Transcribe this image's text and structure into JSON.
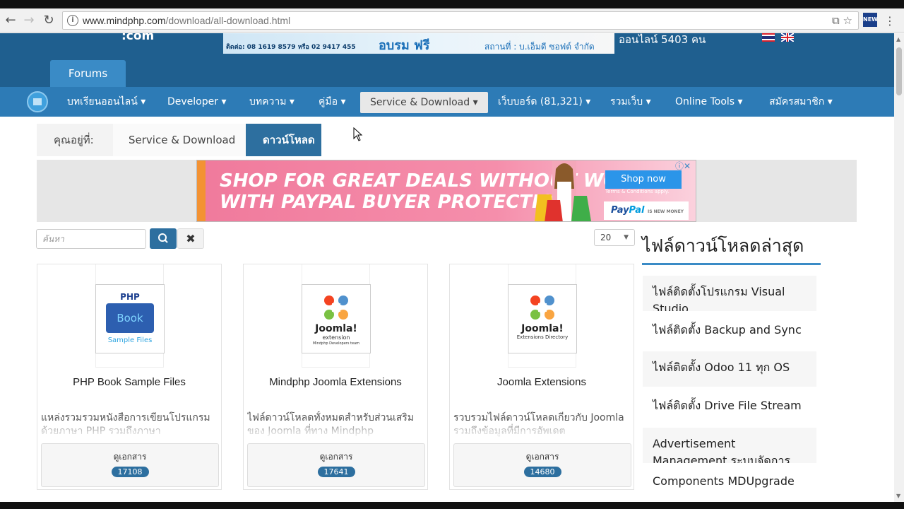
{
  "browser": {
    "url_host": "www.mindphp.com",
    "url_path": "/download/all-download.html"
  },
  "header": {
    "logo_suffix": ":com",
    "banner": {
      "contact": "ติดต่อ: 08 1619 8579 หรือ 02 9417 455",
      "training": "อบรม ฟรี",
      "venue": "สถานที่ : บ.เอ็มดี ซอฟต์ จำกัด"
    },
    "online": "ออนไลน์ 5403 คน",
    "forums_tab": "Forums"
  },
  "nav": {
    "items": [
      {
        "label": "บทเรียนออนไลน์ ▾"
      },
      {
        "label": "Developer ▾"
      },
      {
        "label": "บทความ ▾"
      },
      {
        "label": "คู่มือ ▾"
      },
      {
        "label": "Service & Download ▾"
      },
      {
        "label": "เว็บบอร์ด (81,321) ▾"
      },
      {
        "label": "รวมเว็บ ▾"
      },
      {
        "label": "Online Tools ▾"
      },
      {
        "label": "สมัครสมาชิก ▾"
      }
    ]
  },
  "breadcrumb": {
    "you_are_here": "คุณอยู่ที่:",
    "parent": "Service & Download",
    "current": "ดาวน์โหลด"
  },
  "ad": {
    "line1": "SHOP FOR GREAT DEALS WITHOUT WORRIES",
    "line2": "WITH PAYPAL BUYER PROTECTION.",
    "shop_now": "Shop now",
    "terms": "Terms & Conditions apply.",
    "paypal_a": "Pay",
    "paypal_b": "Pal",
    "paypal_tag": "IS NEW MONEY"
  },
  "toolbar": {
    "search_placeholder": "ค้นหา",
    "per_page": "20"
  },
  "cards": [
    {
      "title": "PHP Book Sample Files",
      "desc": "แหล่งรวมรวมหนังสือการเขียนโปรแกรมด้วยภาษา PHP รวมถึงภาษา",
      "doc_label": "ดูเอกสาร",
      "count": "17108",
      "thumb": {
        "top": "PHP",
        "mid": "Book",
        "bottom": "Sample Files"
      }
    },
    {
      "title": "Mindphp Joomla Extensions",
      "desc": "ไฟล์ดาวน์โหลดทั้งหมดสำหรับส่วนเสริมของ Joomla ที่ทาง Mindphp",
      "doc_label": "ดูเอกสาร",
      "count": "17641",
      "thumb": {
        "top": "Joomla!",
        "mid": "extension",
        "bottom": "Mindphp Developers team"
      }
    },
    {
      "title": "Joomla Extensions",
      "desc": "รวบรวมไฟล์ดาวน์โหลดเกี่ยวกับ Joomla รวมถึงข้อมูลที่มีการอัพเดต",
      "doc_label": "ดูเอกสาร",
      "count": "14680",
      "thumb": {
        "top": "Joomla!",
        "mid": "Extensions Directory",
        "bottom": ""
      }
    }
  ],
  "sidebar": {
    "title": "ไฟล์ดาวน์โหลดล่าสุด",
    "items": [
      {
        "label": "ไฟล์ติดตั้งโปรแกรม Visual Studio"
      },
      {
        "label": "ไฟล์ติดตั้ง Backup and Sync"
      },
      {
        "label": "ไฟล์ติดตั้ง Odoo 11 ทุก OS"
      },
      {
        "label": "ไฟล์ติดตั้ง Drive File Stream"
      },
      {
        "label": "Advertisement Management ระบบจัดการโฆษณา"
      },
      {
        "label": "Components MDUpgrade"
      }
    ]
  },
  "colors": {
    "header": "#1f5f8f",
    "navbar": "#2d7bb6",
    "accent": "#2d6f9f"
  }
}
